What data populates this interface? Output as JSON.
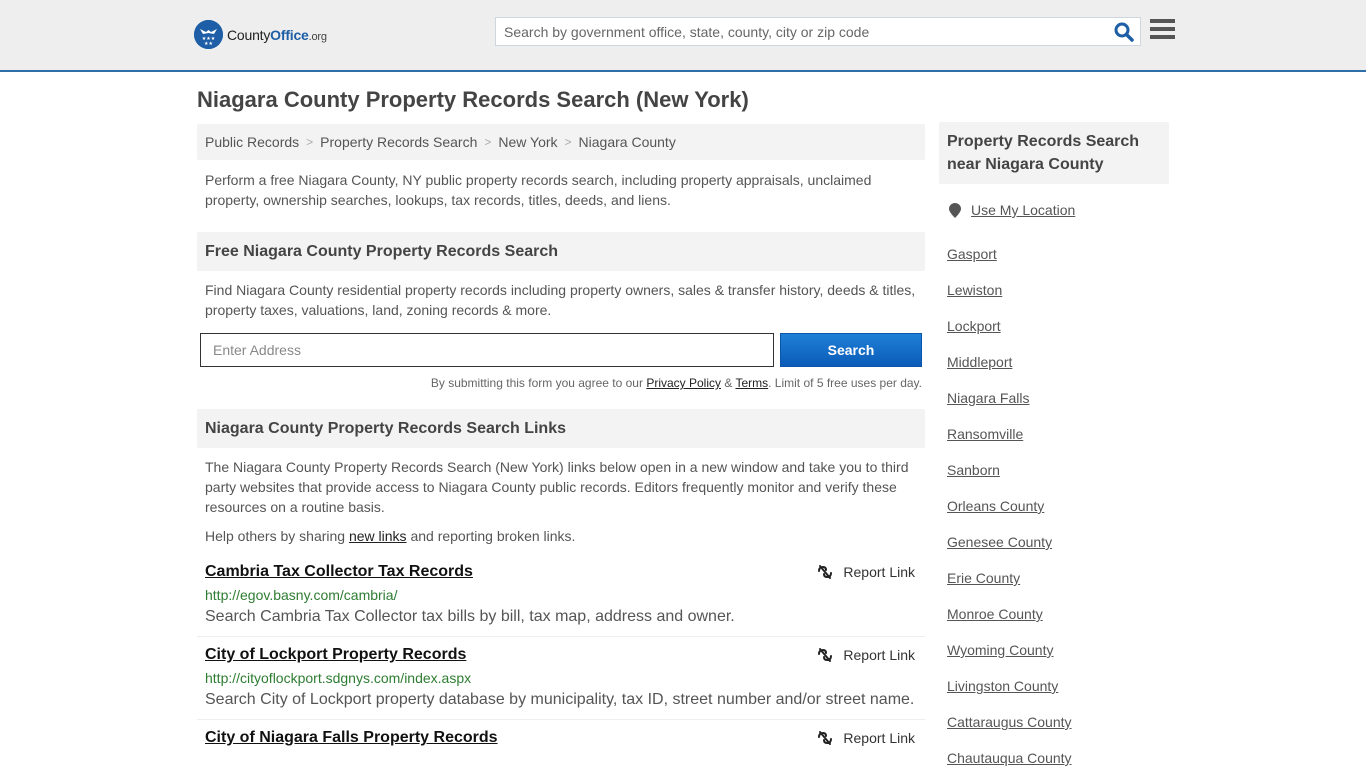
{
  "header": {
    "logo": {
      "brand_prefix": "County",
      "brand_main": "Office",
      "brand_suffix": ".org"
    },
    "search": {
      "placeholder": "Search by government office, state, county, city or zip code",
      "value": ""
    }
  },
  "page_title": "Niagara County Property Records Search (New York)",
  "breadcrumb": [
    {
      "label": "Public Records"
    },
    {
      "label": "Property Records Search"
    },
    {
      "label": "New York"
    },
    {
      "label": "Niagara County"
    }
  ],
  "breadcrumb_separator": ">",
  "intro": "Perform a free Niagara County, NY public property records search, including property appraisals, unclaimed property, ownership searches, lookups, tax records, titles, deeds, and liens.",
  "free_search": {
    "heading": "Free Niagara County Property Records Search",
    "description": "Find Niagara County residential property records including property owners, sales & transfer history, deeds & titles, property taxes, valuations, land, zoning records & more.",
    "address_placeholder": "Enter Address",
    "address_value": "",
    "button_label": "Search",
    "terms_prefix": "By submitting this form you agree to our ",
    "privacy_label": "Privacy Policy",
    "terms_amp": " & ",
    "terms_label": "Terms",
    "terms_suffix": ". Limit of 5 free uses per day."
  },
  "links_section": {
    "heading": "Niagara County Property Records Search Links",
    "description": "The Niagara County Property Records Search (New York) links below open in a new window and take you to third party websites that provide access to Niagara County public records. Editors frequently monitor and verify these resources on a routine basis.",
    "help_prefix": "Help others by sharing ",
    "help_link": "new links",
    "help_suffix": " and reporting broken links.",
    "report_label": "Report Link",
    "items": [
      {
        "title": "Cambria Tax Collector Tax Records",
        "url": "http://egov.basny.com/cambria/",
        "description": "Search Cambria Tax Collector tax bills by bill, tax map, address and owner."
      },
      {
        "title": "City of Lockport Property Records",
        "url": "http://cityoflockport.sdgnys.com/index.aspx",
        "description": "Search City of Lockport property database by municipality, tax ID, street number and/or street name."
      },
      {
        "title": "City of Niagara Falls Property Records",
        "url": "",
        "description": ""
      }
    ]
  },
  "sidebar": {
    "heading": "Property Records Search near Niagara County",
    "use_location": "Use My Location",
    "links": [
      "Gasport",
      "Lewiston",
      "Lockport",
      "Middleport",
      "Niagara Falls",
      "Ransomville",
      "Sanborn",
      "Orleans County",
      "Genesee County",
      "Erie County",
      "Monroe County",
      "Wyoming County",
      "Livingston County",
      "Cattaraugus County",
      "Chautauqua County"
    ]
  },
  "colors": {
    "brand_blue": "#1d5ea6",
    "header_border": "#2f6fa8",
    "button_blue": "#0a5cb8",
    "url_green": "#2e7d32"
  }
}
